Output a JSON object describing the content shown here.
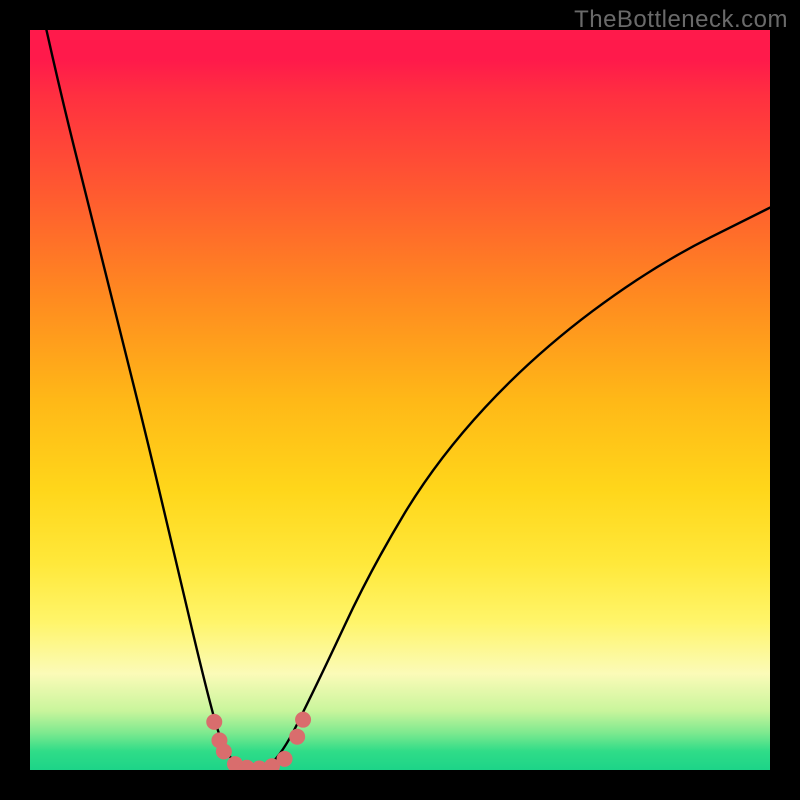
{
  "watermark": "TheBottleneck.com",
  "chart_data": {
    "type": "line",
    "title": "",
    "xlabel": "",
    "ylabel": "",
    "xlim": [
      0,
      1
    ],
    "ylim": [
      0,
      100
    ],
    "series": [
      {
        "name": "bottleneck-curve",
        "x": [
          0.0,
          0.04,
          0.08,
          0.12,
          0.16,
          0.2,
          0.238,
          0.26,
          0.285,
          0.33,
          0.39,
          0.46,
          0.55,
          0.68,
          0.84,
          1.0
        ],
        "values": [
          110,
          92,
          76,
          60,
          44,
          27,
          11,
          3,
          0,
          0,
          12,
          27,
          42,
          56,
          68,
          76
        ]
      }
    ],
    "markers": {
      "name": "highlight-dots",
      "color": "#d96d6d",
      "points": [
        {
          "x": 0.249,
          "y": 6.5
        },
        {
          "x": 0.256,
          "y": 4.0
        },
        {
          "x": 0.262,
          "y": 2.5
        },
        {
          "x": 0.277,
          "y": 0.8
        },
        {
          "x": 0.293,
          "y": 0.3
        },
        {
          "x": 0.31,
          "y": 0.2
        },
        {
          "x": 0.327,
          "y": 0.5
        },
        {
          "x": 0.344,
          "y": 1.5
        },
        {
          "x": 0.361,
          "y": 4.5
        },
        {
          "x": 0.369,
          "y": 6.8
        }
      ]
    },
    "gradient_stops": [
      {
        "pct": 0,
        "color": "#ff1a4b"
      },
      {
        "pct": 50,
        "color": "#ffb817"
      },
      {
        "pct": 85,
        "color": "#fbfbb8"
      },
      {
        "pct": 100,
        "color": "#1dd488"
      }
    ]
  }
}
